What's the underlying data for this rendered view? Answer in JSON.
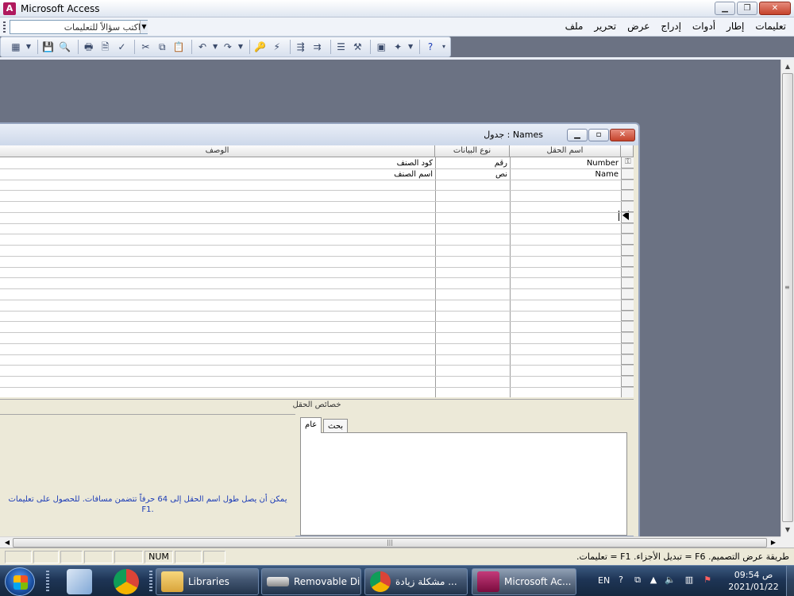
{
  "app": {
    "title": "Microsoft Access"
  },
  "help_box": {
    "placeholder": "اكتب سؤالاً للتعليمات"
  },
  "menu": [
    "ملف",
    "تحرير",
    "عرض",
    "إدراج",
    "أدوات",
    "إطار",
    "تعليمات"
  ],
  "table_window": {
    "caption": "Names : جدول",
    "columns": {
      "field_name": "اسم الحقل",
      "data_type": "نوع البيانات",
      "description": "الوصف"
    },
    "rows": [
      {
        "field_name": "Number",
        "data_type": "رقم",
        "description": "كود الصنف"
      },
      {
        "field_name": "Name",
        "data_type": "نص",
        "description": "اسم الصنف"
      }
    ]
  },
  "field_properties": {
    "label": "خصائص الحقل",
    "tabs": [
      "عام",
      "بحث"
    ],
    "help_line1": "يمكن أن يصل طول اسم الحقل إلى 64 حرفاً تتضمن مسافات. للحصول على تعليمات",
    "help_line2": ".F1"
  },
  "status": {
    "text": "طريقة عرض التصميم. F6 = تبديل الأجزاء. F1 = تعليمات.",
    "num": "NUM"
  },
  "taskbar": {
    "tasks": [
      {
        "label": "Libraries",
        "icon": "folder-icon"
      },
      {
        "label": "Removable Di...",
        "icon": "drive-icon"
      },
      {
        "label": "مشكلة زيادة ...",
        "icon": "chrome-icon"
      },
      {
        "label": "Microsoft Ac...",
        "icon": "access-icon"
      }
    ],
    "lang": "EN",
    "time": "09:54 ص",
    "date": "2021/01/22"
  },
  "colors": {
    "title_accent": "#b0185d",
    "help_text": "#1b3bb6",
    "taskbar": "#1e3556"
  }
}
